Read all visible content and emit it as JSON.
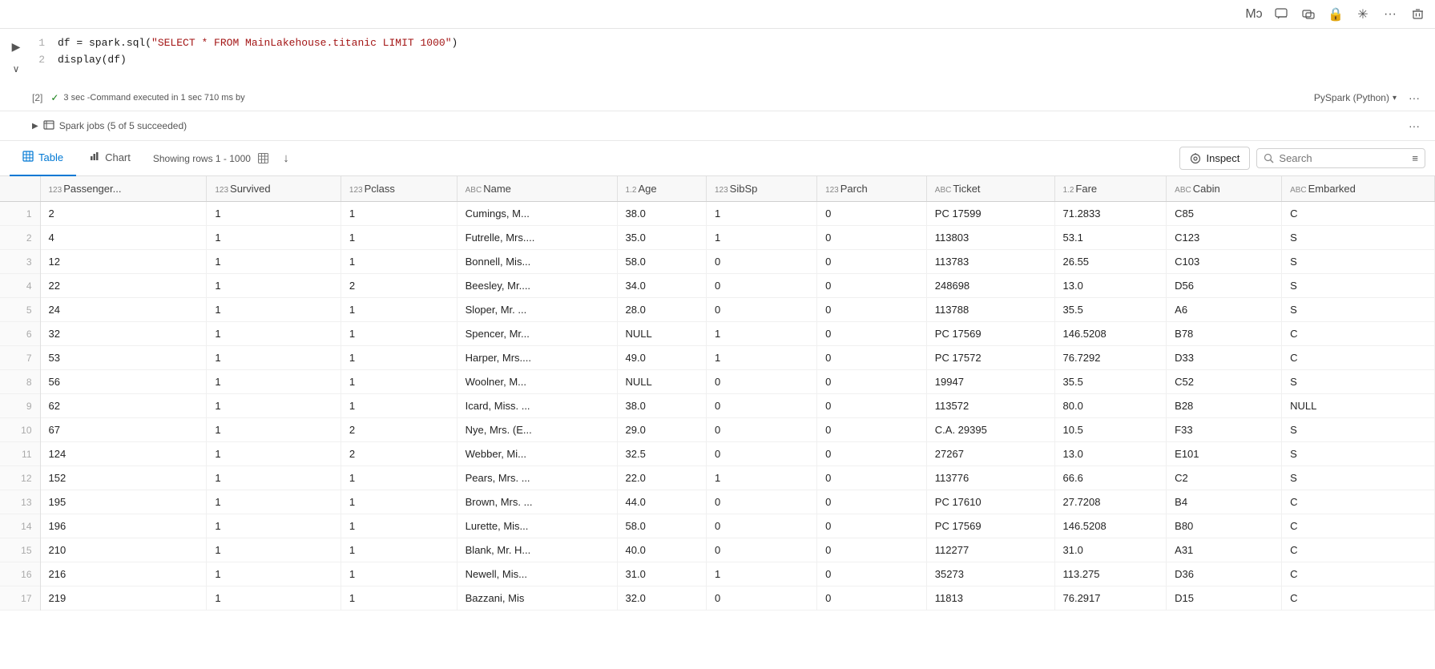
{
  "toolbar": {
    "icons": [
      "M↓",
      "□",
      "□",
      "🔒",
      "✳",
      "...",
      "🗑"
    ]
  },
  "cell": {
    "number": "[2]",
    "run_icon": "▶",
    "chevron_icon": "∨",
    "code_lines": [
      {
        "num": "1",
        "parts": [
          {
            "text": "df = spark.sql(",
            "type": "normal"
          },
          {
            "text": "\"SELECT * FROM MainLakehouse.titanic LIMIT 1000\"",
            "type": "string"
          },
          {
            "text": ")",
            "type": "normal"
          }
        ]
      },
      {
        "num": "2",
        "parts": [
          {
            "text": "display(df)",
            "type": "normal"
          }
        ]
      }
    ],
    "status": "✓  3 sec -Command executed in 1 sec 710 ms by",
    "pyspark_label": "PySpark (Python)",
    "ellipsis": "..."
  },
  "spark_jobs": {
    "expand_icon": "▶",
    "spark_icon": "⚡",
    "label": "Spark jobs (5 of 5 succeeded)"
  },
  "output_toolbar": {
    "tabs": [
      {
        "id": "table",
        "label": "Table",
        "icon": "⊞",
        "active": true
      },
      {
        "id": "chart",
        "label": "Chart",
        "icon": "📈",
        "active": false
      }
    ],
    "rows_info": "Showing rows 1 - 1000",
    "grid_icon": "⊞",
    "download_icon": "↓",
    "inspect_icon": "🔍",
    "inspect_label": "Inspect",
    "search_placeholder": "Search",
    "filter_icon": "≡"
  },
  "table": {
    "columns": [
      {
        "label": "",
        "type": ""
      },
      {
        "label": "Passenger...",
        "type": "123"
      },
      {
        "label": "Survived",
        "type": "123"
      },
      {
        "label": "Pclass",
        "type": "123"
      },
      {
        "label": "Name",
        "type": "ABC"
      },
      {
        "label": "Age",
        "type": "1.2"
      },
      {
        "label": "SibSp",
        "type": "123"
      },
      {
        "label": "Parch",
        "type": "123"
      },
      {
        "label": "Ticket",
        "type": "ABC"
      },
      {
        "label": "Fare",
        "type": "1.2"
      },
      {
        "label": "Cabin",
        "type": "ABC"
      },
      {
        "label": "Embarked",
        "type": "ABC"
      }
    ],
    "rows": [
      [
        1,
        2,
        1,
        1,
        "Cumings, M...",
        "38.0",
        1,
        0,
        "PC 17599",
        "71.2833",
        "C85",
        "C"
      ],
      [
        2,
        4,
        1,
        1,
        "Futrelle, Mrs....",
        "35.0",
        1,
        0,
        "113803",
        "53.1",
        "C123",
        "S"
      ],
      [
        3,
        12,
        1,
        1,
        "Bonnell, Mis...",
        "58.0",
        0,
        0,
        "113783",
        "26.55",
        "C103",
        "S"
      ],
      [
        4,
        22,
        1,
        2,
        "Beesley, Mr....",
        "34.0",
        0,
        0,
        "248698",
        "13.0",
        "D56",
        "S"
      ],
      [
        5,
        24,
        1,
        1,
        "Sloper, Mr. ...",
        "28.0",
        0,
        0,
        "113788",
        "35.5",
        "A6",
        "S"
      ],
      [
        6,
        32,
        1,
        1,
        "Spencer, Mr...",
        "NULL",
        1,
        0,
        "PC 17569",
        "146.5208",
        "B78",
        "C"
      ],
      [
        7,
        53,
        1,
        1,
        "Harper, Mrs....",
        "49.0",
        1,
        0,
        "PC 17572",
        "76.7292",
        "D33",
        "C"
      ],
      [
        8,
        56,
        1,
        1,
        "Woolner, M...",
        "NULL",
        0,
        0,
        "19947",
        "35.5",
        "C52",
        "S"
      ],
      [
        9,
        62,
        1,
        1,
        "Icard, Miss. ...",
        "38.0",
        0,
        0,
        "113572",
        "80.0",
        "B28",
        "NULL"
      ],
      [
        10,
        67,
        1,
        2,
        "Nye, Mrs. (E...",
        "29.0",
        0,
        0,
        "C.A. 29395",
        "10.5",
        "F33",
        "S"
      ],
      [
        11,
        124,
        1,
        2,
        "Webber, Mi...",
        "32.5",
        0,
        0,
        "27267",
        "13.0",
        "E101",
        "S"
      ],
      [
        12,
        152,
        1,
        1,
        "Pears, Mrs. ...",
        "22.0",
        1,
        0,
        "113776",
        "66.6",
        "C2",
        "S"
      ],
      [
        13,
        195,
        1,
        1,
        "Brown, Mrs. ...",
        "44.0",
        0,
        0,
        "PC 17610",
        "27.7208",
        "B4",
        "C"
      ],
      [
        14,
        196,
        1,
        1,
        "Lurette, Mis...",
        "58.0",
        0,
        0,
        "PC 17569",
        "146.5208",
        "B80",
        "C"
      ],
      [
        15,
        210,
        1,
        1,
        "Blank, Mr. H...",
        "40.0",
        0,
        0,
        "112277",
        "31.0",
        "A31",
        "C"
      ],
      [
        16,
        216,
        1,
        1,
        "Newell, Mis...",
        "31.0",
        1,
        0,
        "35273",
        "113.275",
        "D36",
        "C"
      ],
      [
        17,
        219,
        1,
        1,
        "Bazzani, Mis",
        "32.0",
        0,
        0,
        "11813",
        "76.2917",
        "D15",
        "C"
      ]
    ]
  }
}
